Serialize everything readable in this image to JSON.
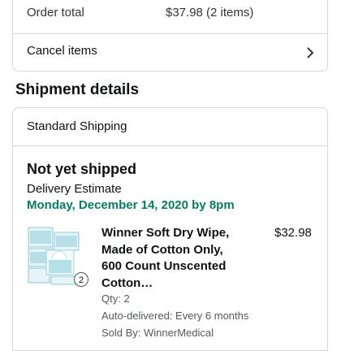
{
  "order_summary": {
    "total_label": "Order total",
    "total_value": "$37.98 (2 items)",
    "cancel_label": "Cancel items"
  },
  "shipment": {
    "section_title": "Shipment details",
    "method": "Standard Shipping",
    "status": "Not yet shipped",
    "estimate_label": "Delivery Estimate",
    "estimate_date": "Monday, December 14, 2020 by 8pm"
  },
  "item": {
    "title": "Winner Soft Dry Wipe, Made of Cotton Only, 600 Count Unscented Cotton…",
    "price": "$32.98",
    "quantity_badge": "2",
    "qty": "Qty: 2",
    "auto_delivered": "Auto-delivered: Every 6 months",
    "sold_by": "Sold By: WinnerMedical"
  },
  "colors": {
    "border": "#d5d9d9",
    "delivery_green": "#067d62",
    "text": "#0f1111",
    "muted": "#565959",
    "product_teal": "#5bb8c8"
  },
  "icons": {
    "cancel_chevron": "chevron-right-icon"
  }
}
